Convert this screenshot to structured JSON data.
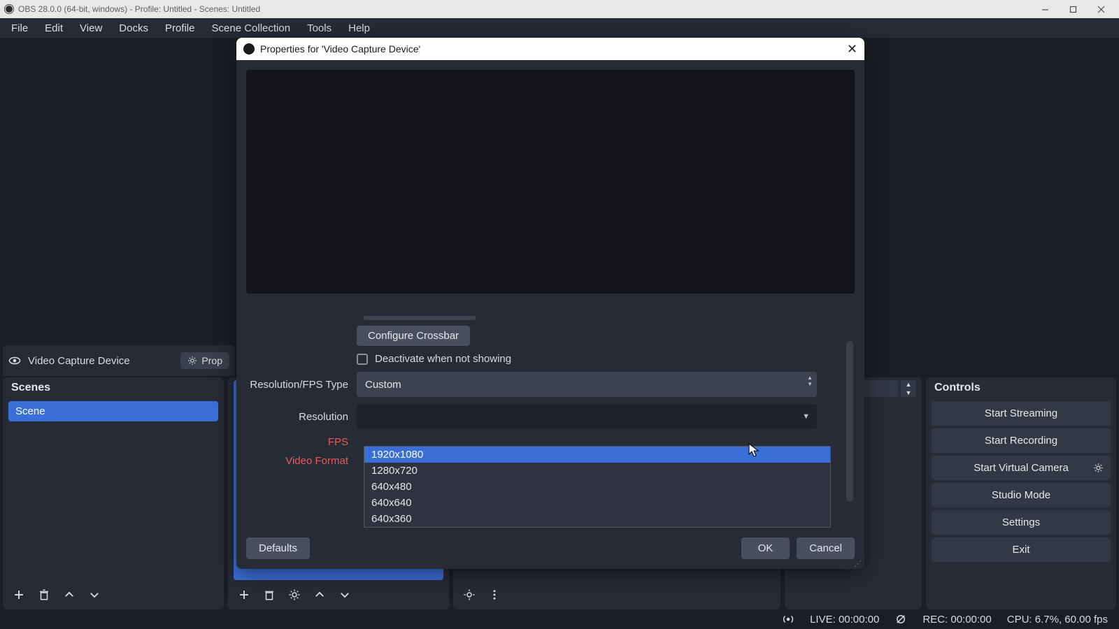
{
  "titlebar": {
    "text": "OBS 28.0.0 (64-bit, windows) - Profile: Untitled - Scenes: Untitled"
  },
  "menubar": {
    "items": [
      "File",
      "Edit",
      "View",
      "Docks",
      "Profile",
      "Scene Collection",
      "Tools",
      "Help"
    ]
  },
  "dialog": {
    "title": "Properties for 'Video Capture Device'",
    "configure_crossbar": "Configure Crossbar",
    "deactivate_label": "Deactivate when not showing",
    "res_fps_type_label": "Resolution/FPS Type",
    "res_fps_type_value": "Custom",
    "resolution_label": "Resolution",
    "resolution_value": "",
    "fps_label": "FPS",
    "video_format_label": "Video Format",
    "resolution_options": [
      "1920x1080",
      "1280x720",
      "640x480",
      "640x640",
      "640x360"
    ],
    "defaults": "Defaults",
    "ok": "OK",
    "cancel": "Cancel"
  },
  "scenes": {
    "header": "Scenes",
    "items": [
      "Scene"
    ]
  },
  "sources": {
    "item_label": "Video Capture Device",
    "prop_btn": "Prop"
  },
  "controls": {
    "header": "Controls",
    "start_streaming": "Start Streaming",
    "start_recording": "Start Recording",
    "start_virtual_camera": "Start Virtual Camera",
    "studio_mode": "Studio Mode",
    "settings": "Settings",
    "exit": "Exit"
  },
  "statusbar": {
    "live": "LIVE: 00:00:00",
    "rec": "REC: 00:00:00",
    "cpu": "CPU: 6.7%, 60.00 fps"
  }
}
